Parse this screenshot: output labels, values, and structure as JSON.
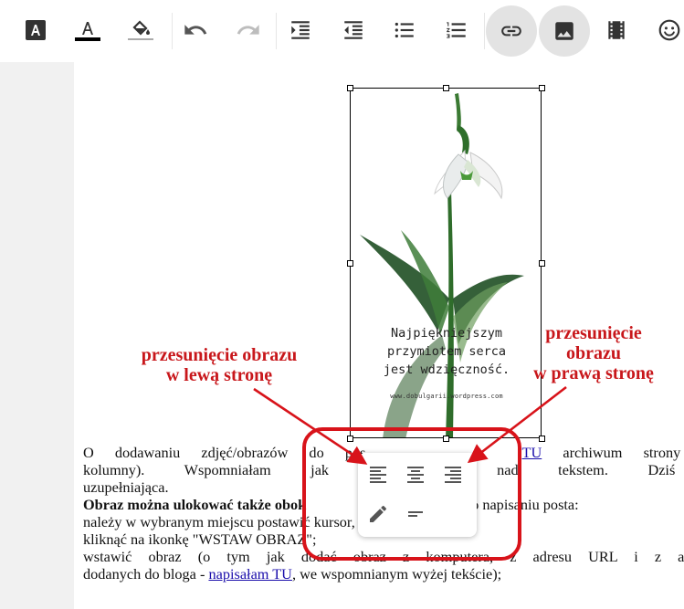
{
  "toolbar": {
    "icons": [
      "text-background-icon",
      "text-color-icon",
      "fill-color-icon",
      "undo-icon",
      "redo-icon",
      "indent-icon",
      "outdent-icon",
      "bulleted-list-icon",
      "numbered-list-icon",
      "link-icon",
      "image-icon",
      "video-icon",
      "emoji-icon"
    ],
    "text_color_underline": "#000000"
  },
  "image": {
    "caption_lines": [
      "Najpiękniejszym",
      "przymiotem serca",
      "jest wdzięczność."
    ],
    "caption_url": "www.dobulgarii.wordpress.com"
  },
  "content": {
    "line1_a": "O dodawaniu zdjęć/obrazów do pos",
    "line1_link": "TU",
    "line1_b": "archiwum strony jest",
    "line2": "kolumny). Wspomniałam jak umie lub nad tekstem. Dziś k",
    "line3": "uzupełniająca.",
    "line4_bold": "Obraz można ulokować także obok",
    "line4_rest": "zrobić po napisaniu posta:",
    "line5": "należy w wybranym miejscu postawić kursor,",
    "line6": "kliknąć na ikonkę \"WSTAW OBRAZ\";",
    "line7": "wstawić obraz (o tym jak dodać obraz z komputera, z adresu URL i z albumu",
    "line8_a": "dodanych do bloga - ",
    "line8_link": "napisałam TU",
    "line8_b": ", we wspomnianym wyżej tekście);"
  },
  "popup": {
    "icons": [
      "align-left-icon",
      "align-center-icon",
      "align-right-icon",
      "edit-pencil-icon",
      "short-text-icon"
    ]
  },
  "annotations": {
    "left_line1": "przesunięcie obrazu",
    "left_line2": "w lewą stronę",
    "right_line1": "przesunięcie",
    "right_line2": "obrazu",
    "right_line3": "w prawą stronę",
    "color": "#d8131a"
  }
}
